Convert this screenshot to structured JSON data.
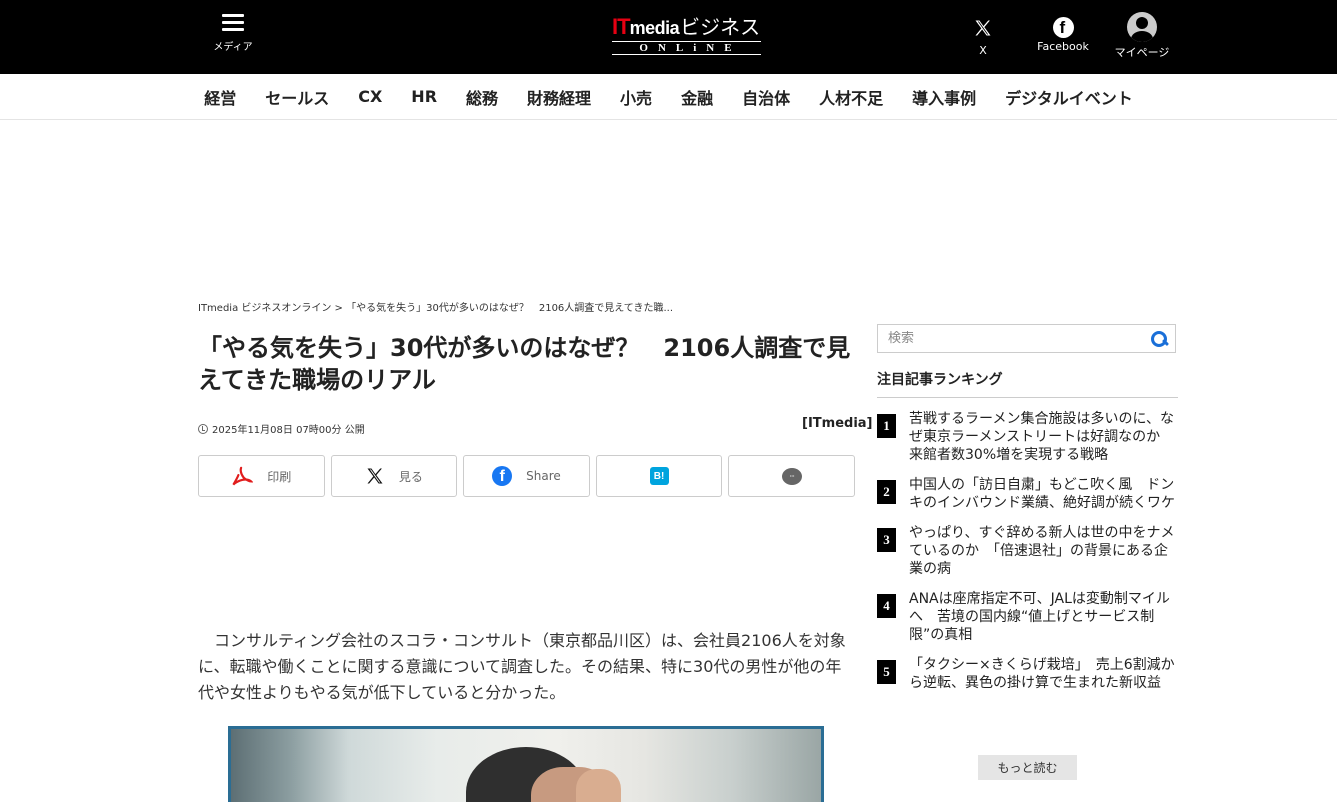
{
  "header": {
    "menu_label": "メディア",
    "logo": {
      "it": "IT",
      "media": "media",
      "biz": "ビジネス",
      "online": "ONLiNE"
    },
    "x_label": "X",
    "facebook_label": "Facebook",
    "mypage_label": "マイページ"
  },
  "nav": [
    "経営",
    "セールス",
    "CX",
    "HR",
    "総務",
    "財務経理",
    "小売",
    "金融",
    "自治体",
    "人材不足",
    "導入事例",
    "デジタルイベント"
  ],
  "breadcrumb": "ITmedia ビジネスオンライン > 「やる気を失う」30代が多いのはなぜ？　2106人調査で見えてきた職...",
  "article": {
    "title": "「やる気を失う」30代が多いのはなぜ？　2106人調査で見えてきた職場のリアル",
    "date": "2025年11月08日 07時00分 公開",
    "source": "[ITmedia]",
    "share": {
      "print": "印刷",
      "x": "見る",
      "facebook": "Share",
      "hatena": "B!",
      "comment": "···"
    },
    "lead": "コンサルティング会社のスコラ・コンサルト（東京都品川区）は、会社員2106人を対象に、転職や働くことに関する意識について調査した。その結果、特に30代の男性が他の年代や女性よりもやる気が低下していると分かった。"
  },
  "sidebar": {
    "search_placeholder": "検索",
    "ranking_title": "注目記事ランキング",
    "ranking": [
      {
        "num": "1",
        "text": "苦戦するラーメン集合施設は多いのに、なぜ東京ラーメンストリートは好調なのか　来館者数30%増を実現する戦略"
      },
      {
        "num": "2",
        "text": "中国人の「訪日自粛」もどこ吹く風　ドンキのインバウンド業績、絶好調が続くワケ"
      },
      {
        "num": "3",
        "text": "やっぱり、すぐ辞める新人は世の中をナメているのか　「倍速退社」の背景にある企業の病"
      },
      {
        "num": "4",
        "text": "ANAは座席指定不可、JALは変動制マイルへ　苦境の国内線“値上げとサービス制限”の真相"
      },
      {
        "num": "5",
        "text": "「タクシー×きくらげ栽培」　売上6割減から逆転、異色の掛け算で生まれた新収益"
      }
    ],
    "more_label": "もっと読む"
  },
  "colors": {
    "header_bg": "#000000",
    "logo_red": "#e60012",
    "hatena_blue": "#00a4de",
    "facebook_blue": "#1877f2",
    "search_blue": "#1a6fd8"
  }
}
